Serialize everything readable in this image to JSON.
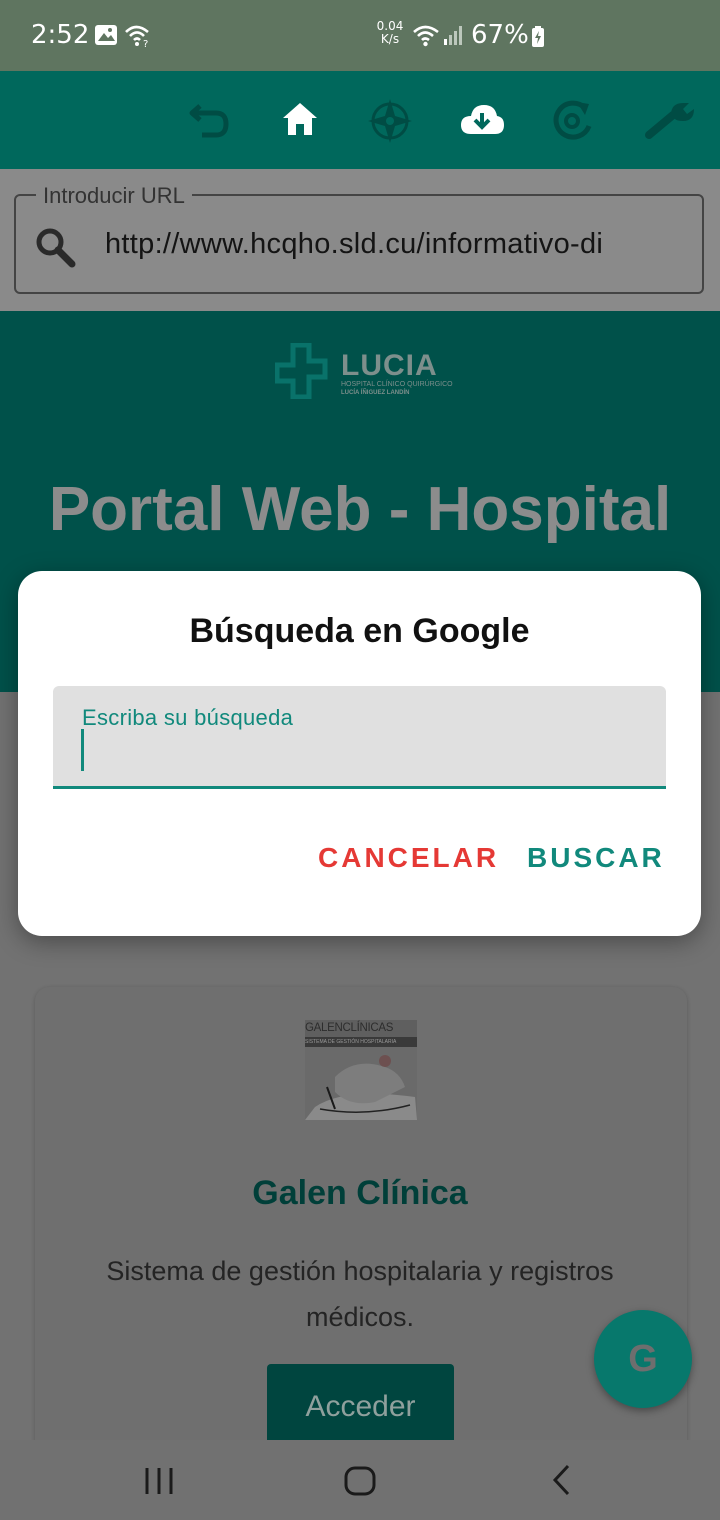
{
  "status_bar": {
    "time": "2:52",
    "net_speed_value": "0.04",
    "net_speed_unit": "K/s",
    "battery": "67%"
  },
  "toolbar": {
    "icons": [
      "back-icon",
      "home-icon",
      "compass-icon",
      "cloud-download-icon",
      "refresh-icon",
      "wrench-icon"
    ]
  },
  "url_bar": {
    "label": "Introducir URL",
    "value": "http://www.hcqho.sld.cu/informativo-di"
  },
  "hero": {
    "logo_text": "LUCIA",
    "logo_subtitle_1": "HOSPITAL CLÍNICO QUIRÚRGICO",
    "logo_subtitle_2": "LUCÍA ÍÑIGUEZ LANDÍN",
    "title": "Portal Web - Hospital"
  },
  "card": {
    "image_text_1": "GALENCLÍNICAS",
    "image_text_2": "SISTEMA DE GESTIÓN HOSPITALARIA",
    "title": "Galen Clínica",
    "description": "Sistema de gestión hospitalaria y registros médicos.",
    "button_label": "Acceder"
  },
  "fab": {
    "label": "G"
  },
  "dialog": {
    "title": "Búsqueda en Google",
    "field_label": "Escriba su búsqueda",
    "field_value": "",
    "cancel_label": "CANCELAR",
    "search_label": "BUSCAR"
  },
  "colors": {
    "accent": "#11897c",
    "toolbar": "#00685c",
    "cancel": "#e53935"
  }
}
